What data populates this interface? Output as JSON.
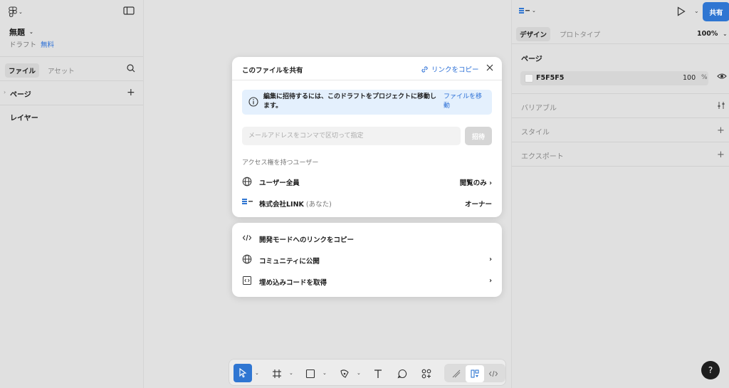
{
  "left_panel": {
    "file_title": "無題",
    "file_status": "ドラフト",
    "file_plan": "無料",
    "tabs": [
      "ファイル",
      "アセット"
    ],
    "pages_label": "ページ",
    "layers_label": "レイヤー"
  },
  "right_panel": {
    "share_label": "共有",
    "tabs": [
      "デザイン",
      "プロトタイプ"
    ],
    "zoom": "100%",
    "page_section": "ページ",
    "page_color_hex": "F5F5F5",
    "page_opacity": "100",
    "opacity_unit": "%",
    "sections": [
      "バリアブル",
      "スタイル",
      "エクスポート"
    ]
  },
  "share_dialog": {
    "title": "このファイルを共有",
    "copy_link": "リンクをコピー",
    "info_text": "編集に招待するには、このドラフトをプロジェクトに移動します。",
    "info_link": "ファイルを移動",
    "email_placeholder": "メールアドレスをコンマで区切って指定",
    "invite_label": "招待",
    "access_heading": "アクセス権を持つユーザー",
    "users": [
      {
        "name": "ユーザー全員",
        "suffix": "",
        "permission": "閲覧のみ  ›"
      },
      {
        "name": "株式会社LINK",
        "suffix": " (あなた)",
        "permission": "オーナー"
      }
    ]
  },
  "options_dialog": {
    "items": [
      {
        "label": "開発モードへのリンクをコピー",
        "arrow": ""
      },
      {
        "label": "コミュニティに公開",
        "arrow": "›"
      },
      {
        "label": "埋め込みコードを取得",
        "arrow": "›"
      }
    ]
  },
  "help_label": "?",
  "colors": {
    "accent": "#2f76d2",
    "link": "#2b6fd6",
    "info_bg": "#e4f0fd"
  }
}
